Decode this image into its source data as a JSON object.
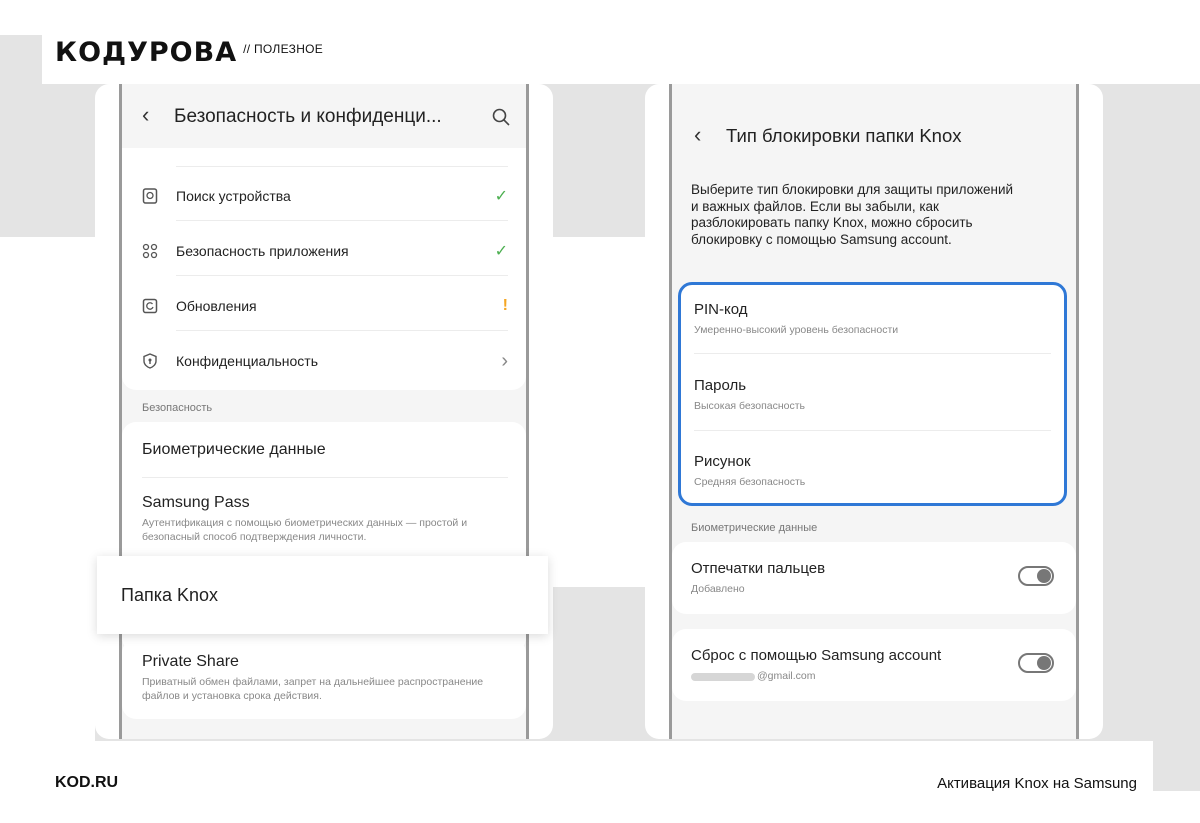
{
  "brand": {
    "logo": "КОДУРОВА",
    "tag": "// ПОЛЕЗНОЕ"
  },
  "footer": {
    "site": "KOD.RU",
    "caption": "Активация Knox на Samsung"
  },
  "left_screen": {
    "title": "Безопасность и конфиденци...",
    "rows": [
      {
        "label": "Поиск устройства",
        "status": "✓"
      },
      {
        "label": "Безопасность приложения",
        "status": "✓"
      },
      {
        "label": "Обновления",
        "status": "!"
      },
      {
        "label": "Конфиденциальность",
        "status": "›"
      }
    ],
    "section": "Безопасность",
    "biometrics": "Биометрические данные",
    "samsung_pass": {
      "title": "Samsung Pass",
      "sub": "Аутентификация с помощью биометрических данных — простой и безопасный способ подтверждения личности."
    },
    "knox_folder": "Папка Knox",
    "private_share": {
      "title": "Private Share",
      "sub": "Приватный обмен файлами, запрет на дальнейшее распространение файлов и установка срока действия."
    }
  },
  "right_screen": {
    "title": "Тип блокировки папки Knox",
    "description": "Выберите тип блокировки для защиты приложений и важных файлов. Если вы забыли, как разблокировать папку Knox, можно сбросить блокировку с помощью Samsung account.",
    "lock_options": [
      {
        "title": "PIN-код",
        "sub": "Умеренно-высокий уровень безопасности"
      },
      {
        "title": "Пароль",
        "sub": "Высокая безопасность"
      },
      {
        "title": "Рисунок",
        "sub": "Средняя безопасность"
      }
    ],
    "section": "Биометрические данные",
    "fingerprints": {
      "title": "Отпечатки пальцев",
      "sub": "Добавлено",
      "enabled": false
    },
    "reset": {
      "title": "Сброс с помощью Samsung account",
      "sub": "@gmail.com",
      "enabled": false
    }
  },
  "colors": {
    "accent_blue": "#2f78d6",
    "check_green": "#4caf50",
    "warn_orange": "#f5a623"
  }
}
